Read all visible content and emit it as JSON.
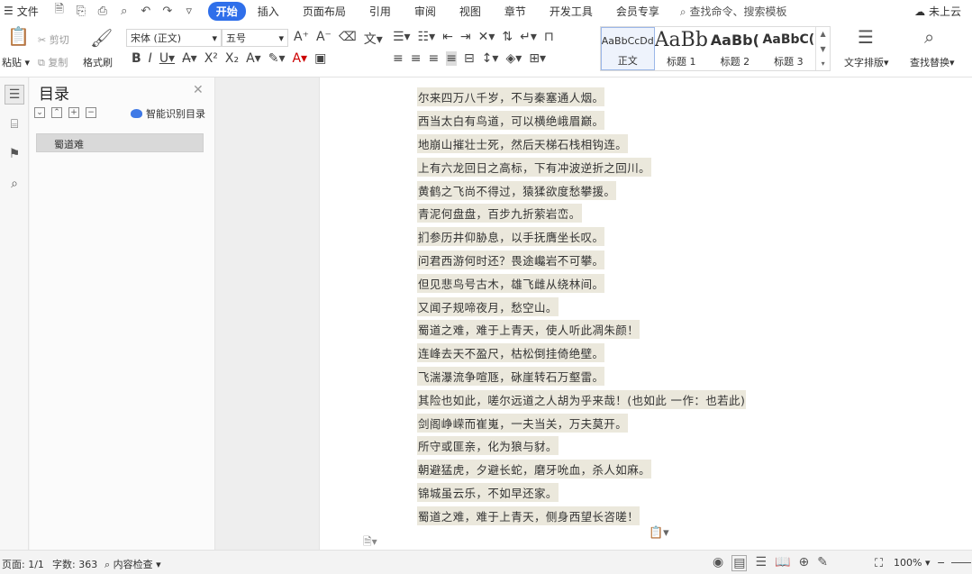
{
  "menubar": {
    "file_label": "文件",
    "tabs": [
      {
        "label": "开始",
        "active": true
      },
      {
        "label": "插入"
      },
      {
        "label": "页面布局"
      },
      {
        "label": "引用"
      },
      {
        "label": "审阅"
      },
      {
        "label": "视图"
      },
      {
        "label": "章节"
      },
      {
        "label": "开发工具"
      },
      {
        "label": "会员专享"
      }
    ],
    "search_placeholder": "查找命令、搜索模板",
    "cloud_status": "未上云"
  },
  "ribbon": {
    "paste": "粘贴",
    "cut": "剪切",
    "copy": "复制",
    "format_painter": "格式刷",
    "font_name": "宋体 (正文)",
    "font_size": "五号",
    "text_layout": "文字排版",
    "find_replace": "查找替换",
    "styles": [
      {
        "preview": "AaBbCcDd",
        "label": "正文",
        "selected": true
      },
      {
        "preview": "AaBb",
        "label": "标题 1"
      },
      {
        "preview": "AaBb(",
        "label": "标题 2"
      },
      {
        "preview": "AaBbC(",
        "label": "标题 3"
      }
    ]
  },
  "toc": {
    "title": "目录",
    "smart_button": "智能识别目录",
    "items": [
      "蜀道难"
    ]
  },
  "document": {
    "lines": [
      "尔来四万八千岁，不与秦塞通人烟。",
      "西当太白有鸟道，可以横绝峨眉巅。",
      "地崩山摧壮士死，然后天梯石栈相钩连。",
      "上有六龙回日之高标，下有冲波逆折之回川。",
      "黄鹤之飞尚不得过，猿猱欲度愁攀援。",
      "青泥何盘盘，百步九折萦岩峦。",
      "扪参历井仰胁息，以手抚膺坐长叹。",
      "问君西游何时还？畏途巉岩不可攀。",
      "但见悲鸟号古木，雄飞雌从绕林间。",
      "又闻子规啼夜月，愁空山。",
      "蜀道之难，难于上青天，使人听此凋朱颜！",
      "连峰去天不盈尺，枯松倒挂倚绝壁。",
      "飞湍瀑流争喧豗，砯崖转石万壑雷。",
      "其险也如此，嗟尔远道之人胡为乎来哉！(也如此 一作：也若此)",
      "剑阁峥嵘而崔嵬，一夫当关，万夫莫开。",
      "所守或匪亲，化为狼与豺。",
      "朝避猛虎，夕避长蛇，磨牙吮血，杀人如麻。",
      "锦城虽云乐，不如早还家。",
      "蜀道之难，难于上青天，侧身西望长咨嗟！"
    ]
  },
  "status": {
    "page": "页面: 1/1",
    "word_count": "字数: 363",
    "content_check": "内容检查",
    "zoom": "100%"
  }
}
